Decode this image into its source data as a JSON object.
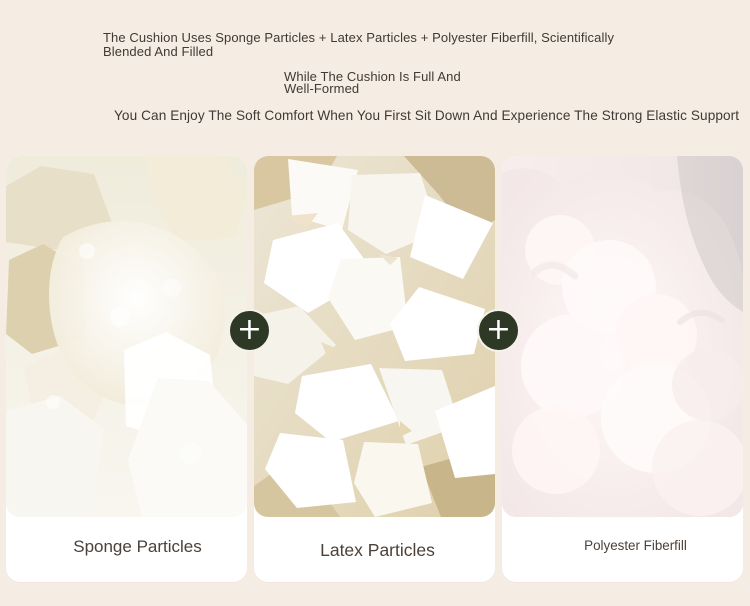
{
  "headline": {
    "line1": "The Cushion Uses Sponge Particles + Latex Particles + Polyester Fiberfill, Scientifically",
    "line2": "Blended And Filled",
    "line3": "While The Cushion Is Full And",
    "line4": "Well-Formed",
    "line5": "You Can Enjoy The Soft Comfort When You First Sit Down And Experience The Strong Elastic Support"
  },
  "materials": [
    {
      "label": "Sponge Particles",
      "icon": "sponge-particles-photo"
    },
    {
      "label": "Latex Particles",
      "icon": "latex-particles-photo"
    },
    {
      "label": "Polyester Fiberfill",
      "icon": "polyester-fiberfill-photo"
    }
  ],
  "connectors": [
    {
      "symbol": "+"
    },
    {
      "symbol": "+"
    }
  ],
  "colors": {
    "background": "#f5ece3",
    "card": "#ffffff",
    "text": "#3f3a35",
    "plus_button": "#2e3925"
  }
}
